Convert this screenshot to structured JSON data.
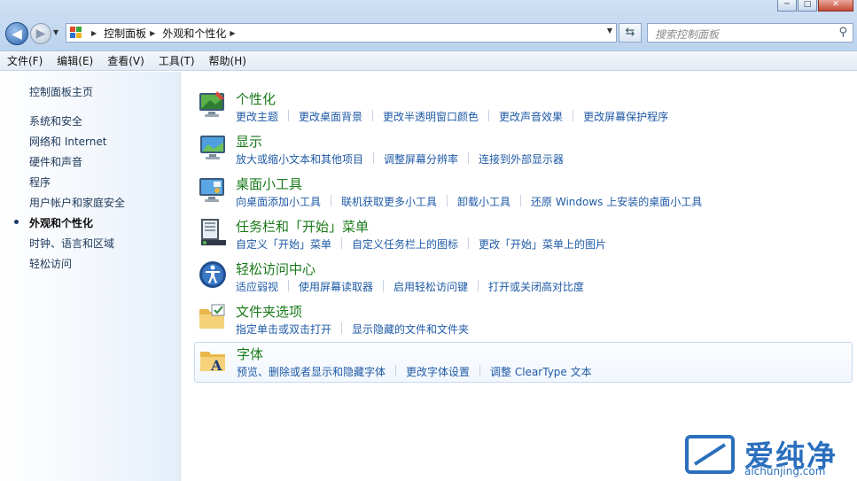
{
  "window": {
    "minimize": "─",
    "maximize": "□",
    "close": "✕"
  },
  "address": {
    "crumbs": [
      "控制面板",
      "外观和个性化"
    ]
  },
  "search": {
    "placeholder": "搜索控制面板"
  },
  "menu": [
    "文件(F)",
    "编辑(E)",
    "查看(V)",
    "工具(T)",
    "帮助(H)"
  ],
  "sidebar": {
    "home": "控制面板主页",
    "items": [
      {
        "label": "系统和安全",
        "active": false
      },
      {
        "label": "网络和 Internet",
        "active": false
      },
      {
        "label": "硬件和声音",
        "active": false
      },
      {
        "label": "程序",
        "active": false
      },
      {
        "label": "用户帐户和家庭安全",
        "active": false
      },
      {
        "label": "外观和个性化",
        "active": true
      },
      {
        "label": "时钟、语言和区域",
        "active": false
      },
      {
        "label": "轻松访问",
        "active": false
      }
    ]
  },
  "categories": [
    {
      "title": "个性化",
      "icon": "personalization-icon",
      "links": [
        "更改主题",
        "更改桌面背景",
        "更改半透明窗口颜色",
        "更改声音效果",
        "更改屏幕保护程序"
      ]
    },
    {
      "title": "显示",
      "icon": "display-icon",
      "links": [
        "放大或缩小文本和其他项目",
        "调整屏幕分辨率",
        "连接到外部显示器"
      ]
    },
    {
      "title": "桌面小工具",
      "icon": "gadgets-icon",
      "links": [
        "向桌面添加小工具",
        "联机获取更多小工具",
        "卸载小工具",
        "还原 Windows 上安装的桌面小工具"
      ]
    },
    {
      "title": "任务栏和「开始」菜单",
      "icon": "taskbar-icon",
      "links": [
        "自定义「开始」菜单",
        "自定义任务栏上的图标",
        "更改「开始」菜单上的图片"
      ]
    },
    {
      "title": "轻松访问中心",
      "icon": "ease-of-access-icon",
      "links": [
        "适应弱视",
        "使用屏幕读取器",
        "启用轻松访问键",
        "打开或关闭高对比度"
      ]
    },
    {
      "title": "文件夹选项",
      "icon": "folder-options-icon",
      "links": [
        "指定单击或双击打开",
        "显示隐藏的文件和文件夹"
      ]
    },
    {
      "title": "字体",
      "icon": "fonts-icon",
      "links": [
        "预览、删除或者显示和隐藏字体",
        "更改字体设置",
        "调整 ClearType 文本"
      ]
    }
  ],
  "watermark": {
    "text": "爱纯净",
    "url": "aichunjing.com"
  },
  "colors": {
    "link": "#1f5aa6",
    "category_title": "#1a7a1a",
    "watermark": "#2b6fbd"
  }
}
